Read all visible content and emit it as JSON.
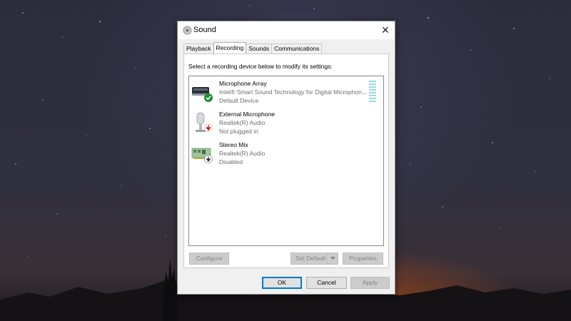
{
  "window": {
    "title": "Sound",
    "close_glyph": "✕"
  },
  "tabs": [
    {
      "label": "Playback"
    },
    {
      "label": "Recording",
      "active": true
    },
    {
      "label": "Sounds"
    },
    {
      "label": "Communications"
    }
  ],
  "instruction": "Select a recording device below to modify its settings:",
  "devices": [
    {
      "name": "Microphone Array",
      "driver": "Intel® Smart Sound Technology for Digital Microphon...",
      "status": "Default Device",
      "icon": "microphone-array-icon",
      "badge": "check-badge-icon"
    },
    {
      "name": "External Microphone",
      "driver": "Realtek(R) Audio",
      "status": "Not plugged in",
      "icon": "external-microphone-icon",
      "badge": "unplugged-badge-icon"
    },
    {
      "name": "Stereo Mix",
      "driver": "Realtek(R) Audio",
      "status": "Disabled",
      "icon": "stereo-mix-icon",
      "badge": "disabled-badge-icon"
    }
  ],
  "buttons": {
    "configure": "Configure",
    "set_default": "Set Default",
    "properties": "Properties",
    "ok": "OK",
    "cancel": "Cancel",
    "apply": "Apply"
  },
  "colors": {
    "accent": "#0078d7",
    "level_meter": "#9ad7e8",
    "default_badge": "#1e8c2e",
    "unplugged_badge": "#d0281f"
  }
}
